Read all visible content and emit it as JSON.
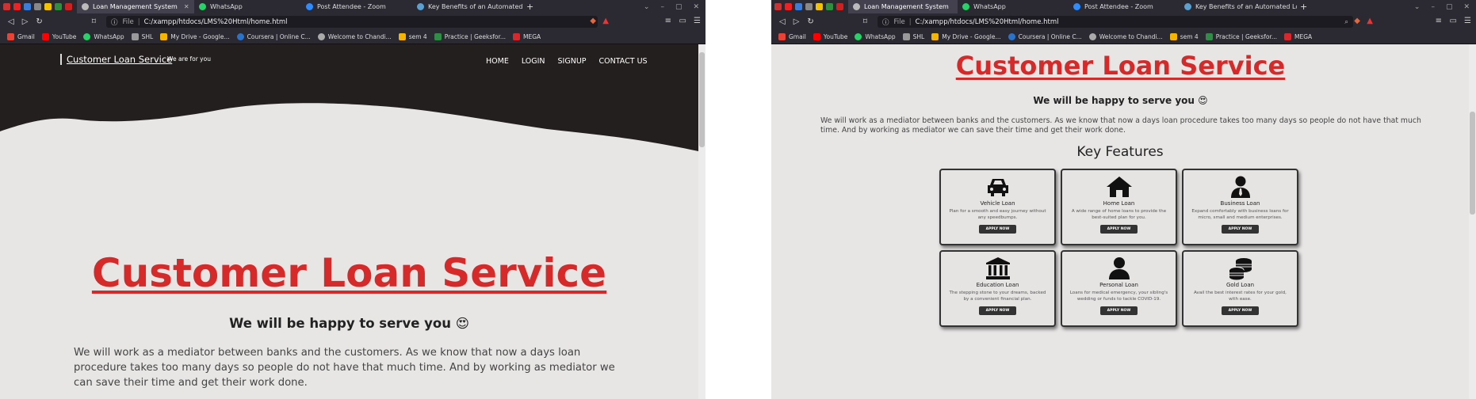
{
  "browser": {
    "tabs": [
      {
        "label": "Loan Management System",
        "active": true
      },
      {
        "label": "WhatsApp",
        "active": false
      },
      {
        "label": "Post Attendee - Zoom",
        "active": false
      },
      {
        "label": "Key Benefits of an Automated Loan M",
        "active": false
      }
    ],
    "file_label": "File",
    "url": "C:/xampp/htdocs/LMS%20Html/home.html",
    "bookmarks": [
      "Gmail",
      "YouTube",
      "WhatsApp",
      "SHL",
      "My Drive - Google...",
      "Coursera | Online C...",
      "Welcome to Chandi...",
      "sem 4",
      "Practice | Geeksfor...",
      "MEGA"
    ],
    "colors": {
      "chrome": "#2b2a33",
      "active_tab": "#42414d"
    }
  },
  "left": {
    "brand": "Customer Loan Service",
    "tagline": "We are for you",
    "nav": [
      "HOME",
      "LOGIN",
      "SIGNUP",
      "CONTACT US"
    ],
    "title": "Customer Loan Service",
    "subtitle": "We will be happy to serve you 😍",
    "body": "We will work as a mediator between banks and the customers. As we know that now a days loan procedure takes too many days so people do not have that much time. And by working as mediator we can save their time and get their work done."
  },
  "right": {
    "title": "Customer Loan Service",
    "subtitle": "We will be happy to serve you 😍",
    "body": "We will work as a mediator between banks and the customers. As we know that now a days loan procedure takes too many days so people do not have that much time. And by working as mediator we can save their time and get their work done.",
    "features_heading": "Key Features",
    "apply_label": "APPLY NOW",
    "features": [
      {
        "icon": "car-icon",
        "title": "Vehicle Loan",
        "desc": "Plan for a smooth and easy journey without any speedbumps."
      },
      {
        "icon": "home-icon",
        "title": "Home Loan",
        "desc": "A wide range of home loans to provide the best-suited plan for you."
      },
      {
        "icon": "businessman-icon",
        "title": "Business Loan",
        "desc": "Expand comfortably with business loans for micro, small and medium enterprises."
      },
      {
        "icon": "bank-icon",
        "title": "Education Loan",
        "desc": "The stepping stone to your dreams, backed by a convenient financial plan."
      },
      {
        "icon": "person-icon",
        "title": "Personal Loan",
        "desc": "Loans for medical emergency, your sibling's wedding or funds to tackle COVID-19."
      },
      {
        "icon": "coins-icon",
        "title": "Gold Loan",
        "desc": "Avail the best interest rates for your gold, with ease."
      }
    ]
  },
  "colors": {
    "accent": "#d62a2a",
    "hero": "#231f1e",
    "page_bg": "#e8e6e5"
  }
}
